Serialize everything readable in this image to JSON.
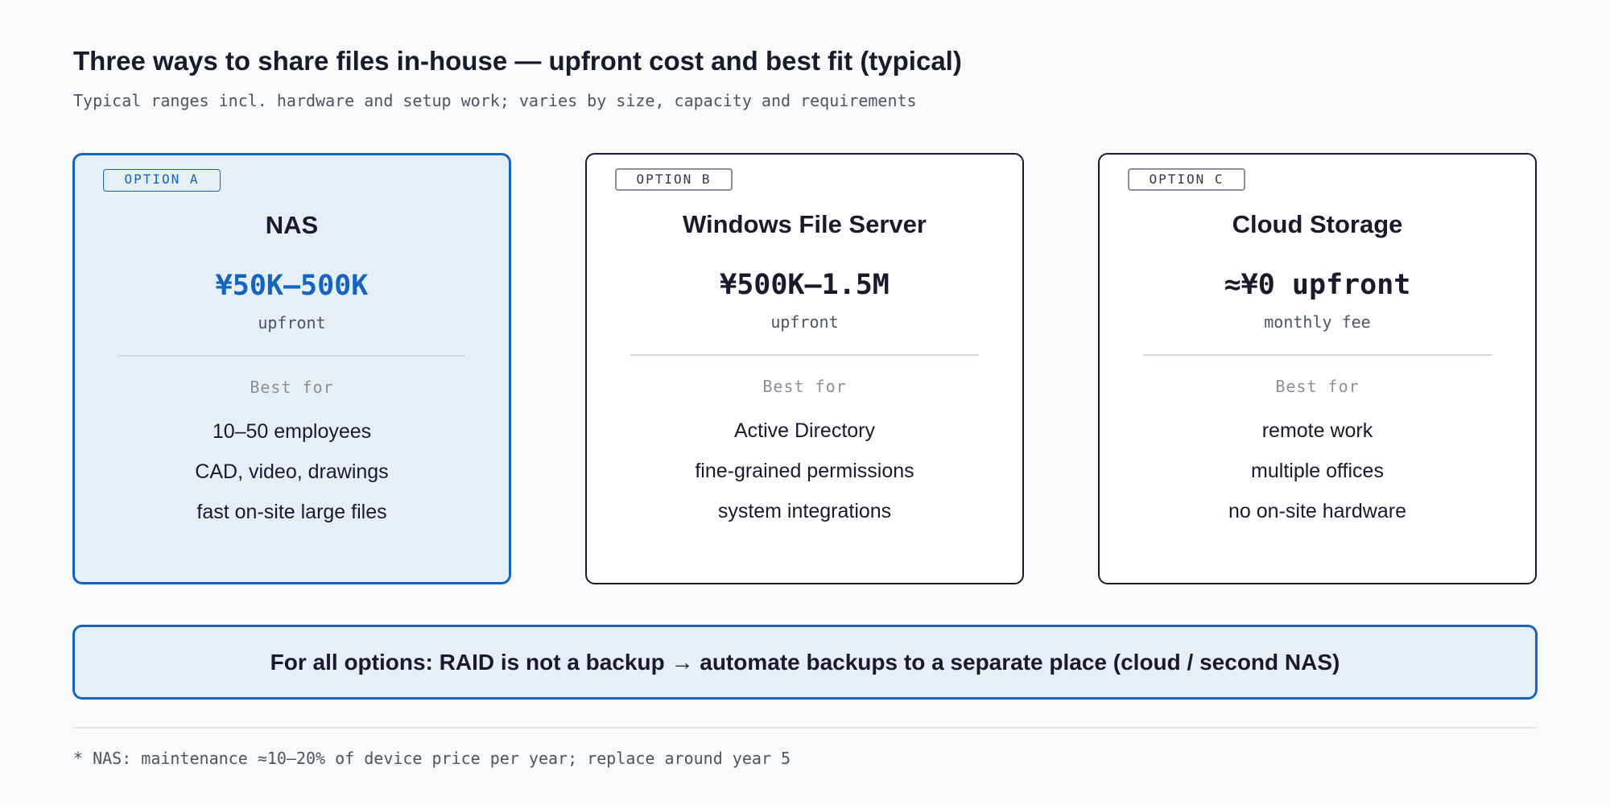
{
  "title": "Three ways to share files in-house — upfront cost and best fit (typical)",
  "subtitle": "Typical ranges incl. hardware and setup work; varies by size, capacity and requirements",
  "colors": {
    "accent": "#1565c0",
    "highlight_bg": "#e6eef7",
    "text": "#1a1a2e",
    "muted": "#4b5563"
  },
  "options": [
    {
      "tag": "OPTION A",
      "name": "NAS",
      "price": "¥50K–500K",
      "price_note": "upfront",
      "best_for_label": "Best for",
      "best_for": [
        "10–50 employees",
        "CAD, video, drawings",
        "fast on-site large files"
      ],
      "highlighted": true
    },
    {
      "tag": "OPTION B",
      "name": "Windows File Server",
      "price": "¥500K–1.5M",
      "price_note": "upfront",
      "best_for_label": "Best for",
      "best_for": [
        "Active Directory",
        "fine-grained permissions",
        "system integrations"
      ],
      "highlighted": false
    },
    {
      "tag": "OPTION C",
      "name": "Cloud Storage",
      "price": "≈¥0 upfront",
      "price_note": "monthly fee",
      "best_for_label": "Best for",
      "best_for": [
        "remote work",
        "multiple offices",
        "no on-site hardware"
      ],
      "highlighted": false
    }
  ],
  "banner": "For all options: RAID is not a backup → automate backups to a separate place (cloud / second NAS)",
  "footnote": "* NAS: maintenance ≈10–20% of device price per year; replace around year 5"
}
